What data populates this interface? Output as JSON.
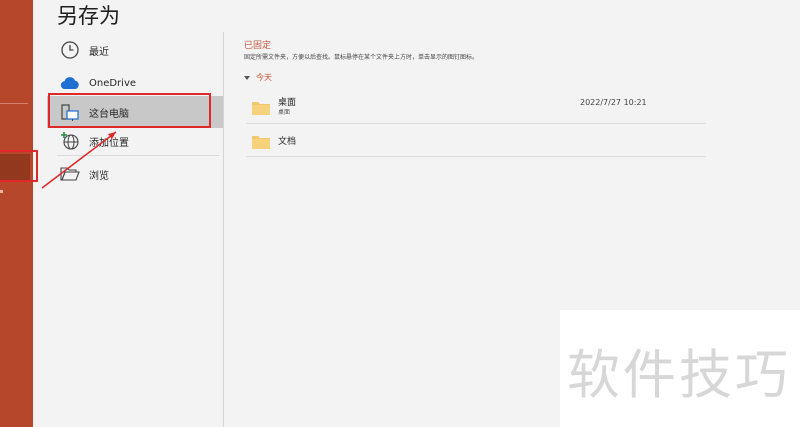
{
  "page": {
    "title": "另存为"
  },
  "nav": {
    "items": [
      {
        "label": "最近",
        "icon": "clock-icon"
      },
      {
        "label": "OneDrive",
        "icon": "cloud-icon"
      },
      {
        "label": "这台电脑",
        "icon": "computer-icon",
        "active": true
      },
      {
        "label": "添加位置",
        "icon": "add-place-icon"
      },
      {
        "label": "浏览",
        "icon": "folder-open-icon"
      }
    ]
  },
  "pinned": {
    "heading": "已固定",
    "description": "固定所需文件夹，方便以后查找。鼠标悬停在某个文件夹上方时，单击显示的图钉图标。"
  },
  "today": {
    "heading": "今天",
    "items": [
      {
        "name": "桌面",
        "path": "桌面",
        "date": "2022/7/27 10:21"
      },
      {
        "name": "文档",
        "path": "",
        "date": ""
      }
    ]
  },
  "watermark": {
    "text": "软件技巧"
  },
  "colors": {
    "accent": "#b7472a",
    "annotation": "#e0282b",
    "folder": "#f2c86c"
  }
}
